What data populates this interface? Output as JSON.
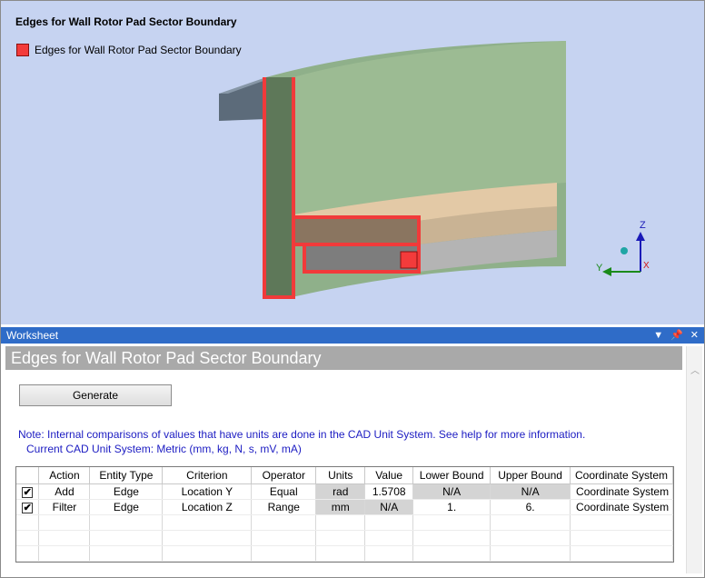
{
  "viewport": {
    "title": "Edges for Wall Rotor Pad Sector Boundary",
    "legend_label": "Edges for Wall Rotor Pad Sector Boundary",
    "legend_color": "#f33b3b",
    "axes": {
      "z": "Z",
      "y": "Y",
      "x": "X"
    }
  },
  "worksheet": {
    "bar_label": "Worksheet",
    "title": "Edges for Wall Rotor Pad Sector Boundary",
    "generate_label": "Generate",
    "note": "Note: Internal comparisons of values that have units are done in the CAD Unit System. See help for more information.",
    "current_unit": "Current CAD Unit System:  Metric (mm, kg, N, s, mV, mA)",
    "columns": [
      "",
      "Action",
      "Entity Type",
      "Criterion",
      "Operator",
      "Units",
      "Value",
      "Lower Bound",
      "Upper Bound",
      "Coordinate System"
    ],
    "rows": [
      {
        "checked": "✔",
        "action": "Add",
        "entity": "Edge",
        "criterion": "Location Y",
        "operator": "Equal",
        "units": "rad",
        "value": "1.5708",
        "lower": "N/A",
        "upper": "N/A",
        "coord": "Coordinate System"
      },
      {
        "checked": "✔",
        "action": "Filter",
        "entity": "Edge",
        "criterion": "Location Z",
        "operator": "Range",
        "units": "mm",
        "value": "N/A",
        "lower": "1.",
        "upper": "6.",
        "coord": "Coordinate System"
      }
    ]
  }
}
